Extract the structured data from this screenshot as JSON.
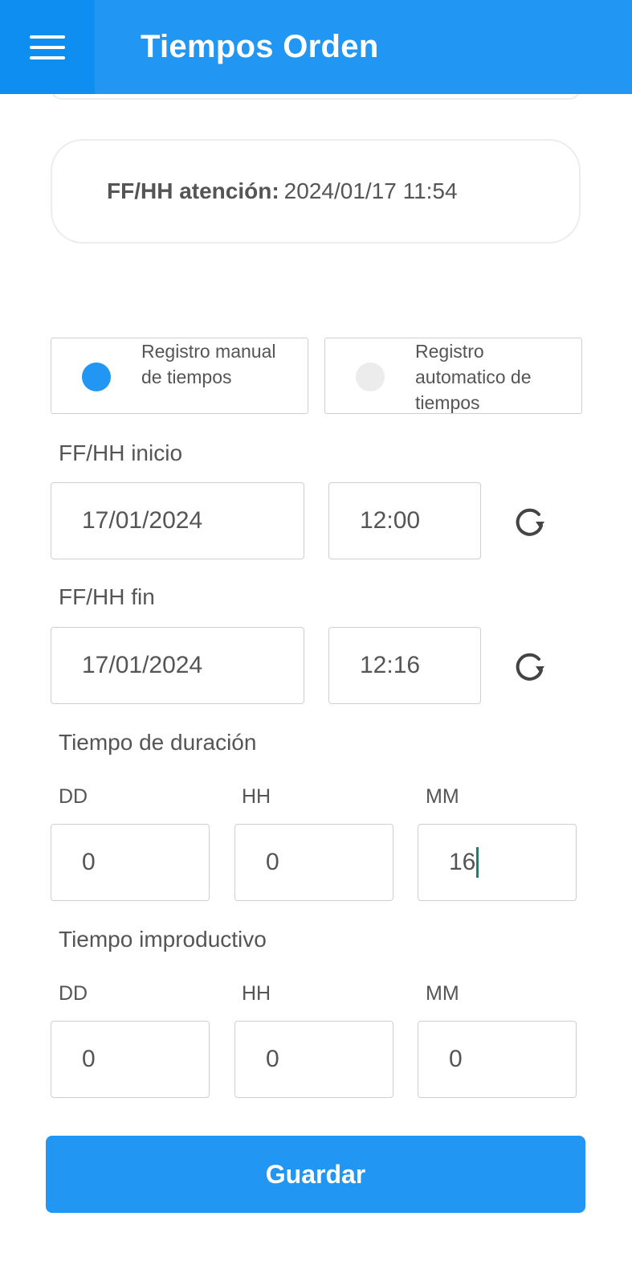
{
  "header": {
    "title": "Tiempos Orden",
    "menu_icon": "hamburger-menu-icon"
  },
  "attention": {
    "label": "FF/HH atención:",
    "value": "2024/01/17 11:54"
  },
  "registro": {
    "manual": {
      "label": "Registro manual de tiempos",
      "selected": true
    },
    "automatico": {
      "label": "Registro automatico de tiempos",
      "selected": false
    }
  },
  "inicio": {
    "label": "FF/HH inicio",
    "date": "17/01/2024",
    "time": "12:00",
    "refresh_icon": "refresh-icon"
  },
  "fin": {
    "label": "FF/HH fin",
    "date": "17/01/2024",
    "time": "12:16",
    "refresh_icon": "refresh-icon"
  },
  "duracion": {
    "label": "Tiempo de duración",
    "dd_label": "DD",
    "hh_label": "HH",
    "mm_label": "MM",
    "dd": "0",
    "hh": "0",
    "mm": "16"
  },
  "improductivo": {
    "label": "Tiempo improductivo",
    "dd_label": "DD",
    "hh_label": "HH",
    "mm_label": "MM",
    "dd": "0",
    "hh": "0",
    "mm": "0"
  },
  "save_label": "Guardar",
  "colors": {
    "primary": "#2196f3",
    "header_menu_bg": "#0d8ef0",
    "caret": "#0a8a6a",
    "radio_off": "#ececec"
  }
}
